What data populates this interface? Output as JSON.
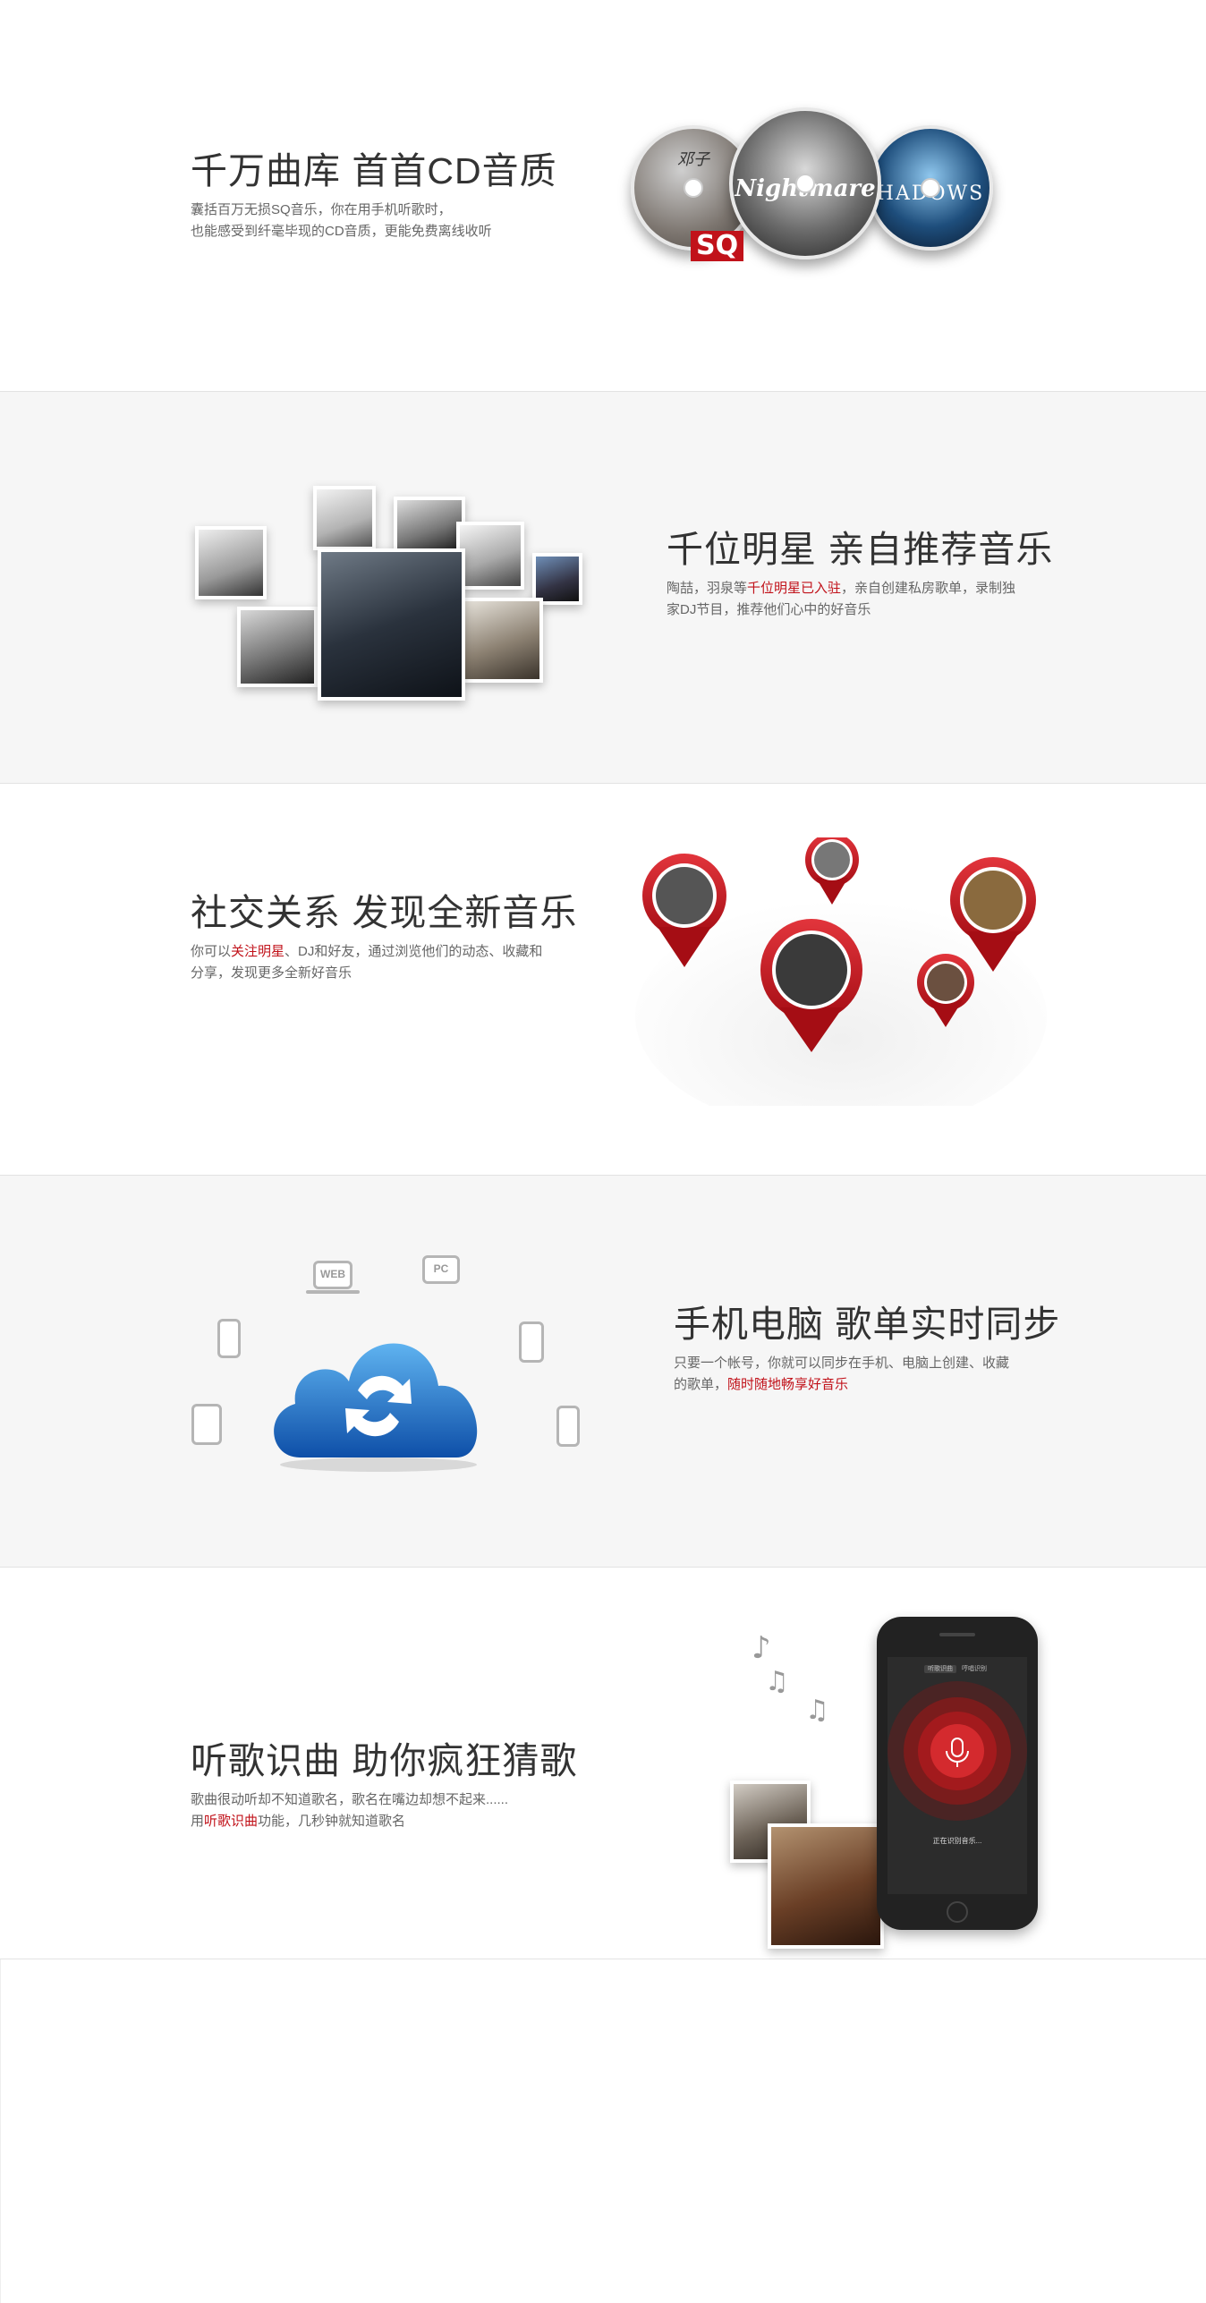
{
  "sections": [
    {
      "title": "千万曲库 首首CD音质",
      "desc_line1": "囊括百万无损SQ音乐，你在用手机听歌时，",
      "desc_line2": "也能感受到纤毫毕现的CD音质，更能免费离线收听",
      "art": {
        "disc1_text": "邓子",
        "disc2_text": "Nightmare",
        "disc3_text": "HADOWS",
        "sq_badge": "SQ"
      }
    },
    {
      "title": "千位明星 亲自推荐音乐",
      "desc_pre": "陶喆，羽泉等",
      "desc_highlight": "千位明星已入驻",
      "desc_post": "，亲自创建私房歌单，录制独",
      "desc_line2": "家DJ节目，推荐他们心中的好音乐"
    },
    {
      "title": "社交关系 发现全新音乐",
      "desc_pre": "你可以",
      "desc_highlight": "关注明星",
      "desc_post": "、DJ和好友，通过浏览他们的动态、收藏和",
      "desc_line2": "分享，发现更多全新好音乐"
    },
    {
      "title": "手机电脑 歌单实时同步",
      "desc_line1": "只要一个帐号，你就可以同步在手机、电脑上创建、收藏",
      "desc_pre2": "的歌单，",
      "desc_highlight": "随时随地畅享好音乐",
      "art": {
        "web_label": "WEB",
        "pc_label": "PC"
      }
    },
    {
      "title": "听歌识曲 助你疯狂猜歌",
      "desc_line1": "歌曲很动听却不知道歌名，歌名在嘴边却想不起来......",
      "desc_pre2": "用",
      "desc_highlight": "听歌识曲",
      "desc_post2": "功能，几秒钟就知道歌名",
      "art": {
        "listening_text": "正在识别音乐...",
        "tab1": "听歌识曲",
        "tab2": "哼唱识别",
        "note1": "♪",
        "note2": "♫",
        "note3": "♫"
      }
    }
  ],
  "colors": {
    "accent": "#c1121a",
    "cloud": "#1f6fc4",
    "section_gray": "#f6f6f6"
  }
}
